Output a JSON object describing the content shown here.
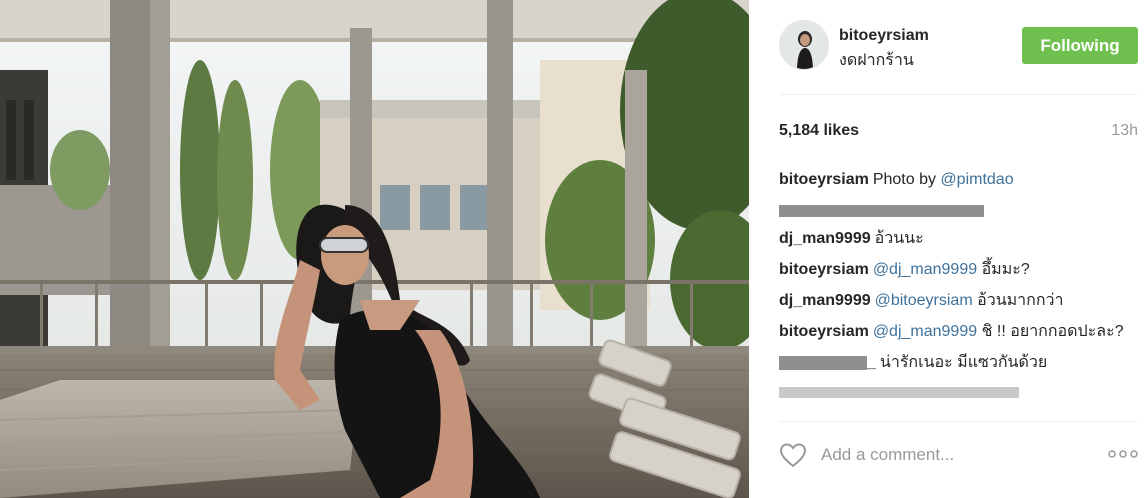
{
  "post": {
    "username": "bitoeyrsiam",
    "location": "งดฝากร้าน",
    "follow_label": "Following",
    "likes": "5,184 likes",
    "time": "13h"
  },
  "comments": [
    {
      "user": "bitoeyrsiam",
      "text": "Photo by ",
      "mention": "@pimtdao",
      "rest": ""
    },
    {
      "user": "",
      "redacted": true,
      "text": ""
    },
    {
      "user": "dj_man9999",
      "text": "อ้วนนะ"
    },
    {
      "user": "bitoeyrsiam",
      "mention": "@dj_man9999",
      "text": " อึ้มมะ?"
    },
    {
      "user": "dj_man9999",
      "mention": "@bitoeyrsiam",
      "text": " อ้วนมากกว่า"
    },
    {
      "user": "bitoeyrsiam",
      "mention": "@dj_man9999",
      "text": " ชิ !! อยากกอดปะละ?"
    },
    {
      "user": "",
      "redacted_user_suffix": "_",
      "text": "น่ารักเนอะ มีแซวกันด้วย"
    },
    {
      "user": "",
      "partial": true,
      "text": ""
    }
  ],
  "footer": {
    "placeholder": "Add a comment...",
    "heart_icon": "heart-outline-icon",
    "more_icon": "ellipsis-icon"
  },
  "colors": {
    "follow_button": "#70c050",
    "mention": "#3f729b",
    "muted": "#999999"
  }
}
